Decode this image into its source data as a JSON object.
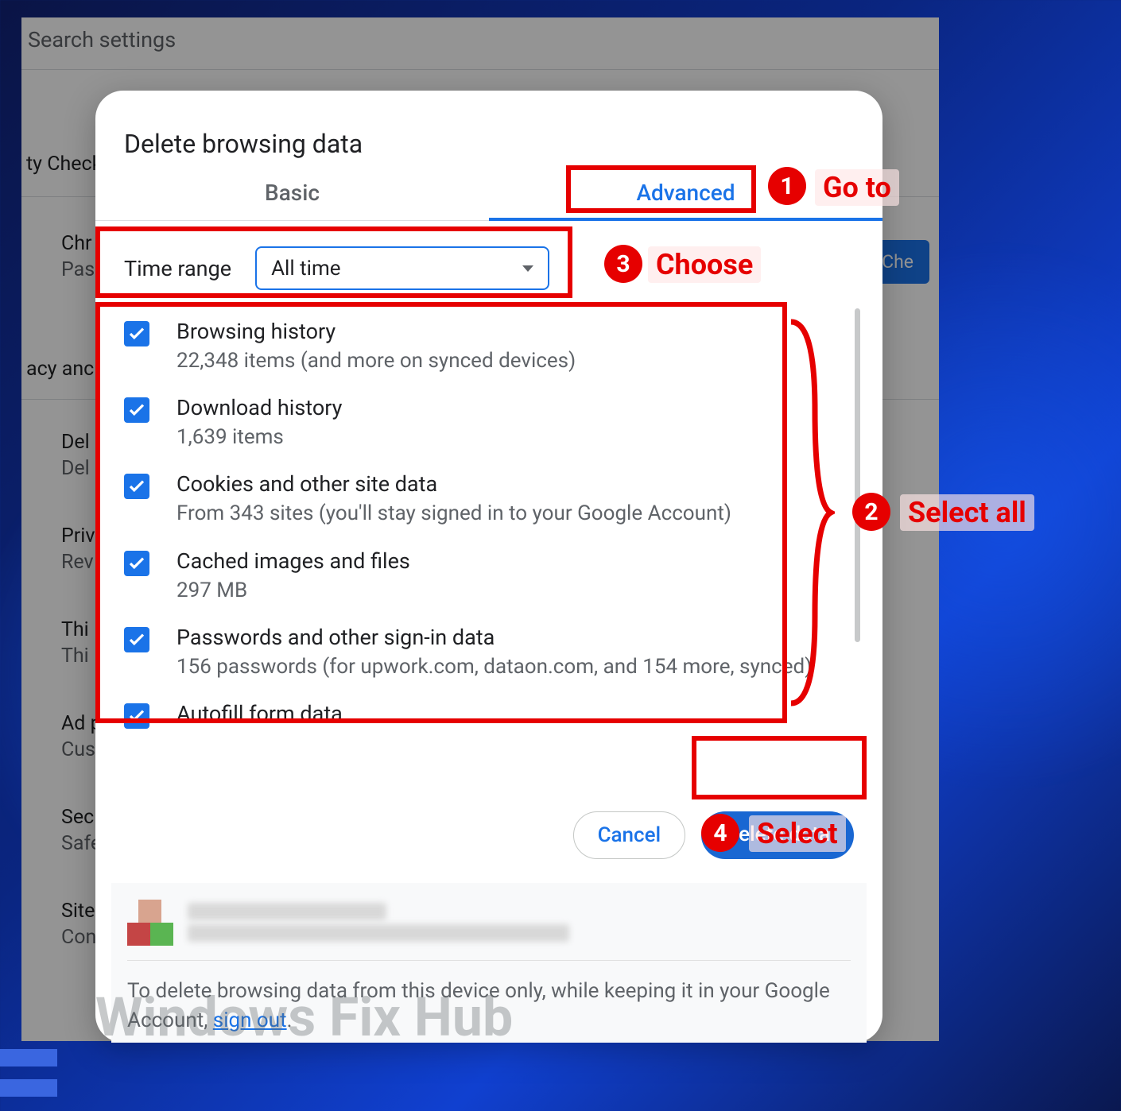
{
  "background_settings": {
    "search_placeholder": "Search settings",
    "section_safety_check": "ty Check",
    "item_chrome": "Chr",
    "item_chrome_sub": "Pass",
    "safety_btn": "ety Che",
    "section_privacy": "acy anc",
    "item_delete": "Del",
    "item_delete_sub": "Del",
    "item_privacy": "Priv",
    "item_privacy_sub": "Rev",
    "item_third": "Thi",
    "item_third_sub": "Thi",
    "item_ad": "Ad p",
    "item_ad_sub": "Cus",
    "item_security": "Sec",
    "item_security_sub": "Safe",
    "item_site": "Site",
    "item_site_sub": "Con"
  },
  "dialog": {
    "title": "Delete browsing data",
    "tabs": {
      "basic": "Basic",
      "advanced": "Advanced"
    },
    "time_range_label": "Time range",
    "time_range_value": "All time",
    "options": [
      {
        "title": "Browsing history",
        "sub": "22,348 items (and more on synced devices)"
      },
      {
        "title": "Download history",
        "sub": "1,639 items"
      },
      {
        "title": "Cookies and other site data",
        "sub": "From 343 sites (you'll stay signed in to your Google Account)"
      },
      {
        "title": "Cached images and files",
        "sub": "297 MB"
      },
      {
        "title": "Passwords and other sign-in data",
        "sub": "156 passwords (for upwork.com, dataon.com, and 154 more, synced)"
      },
      {
        "title": "Autofill form data",
        "sub": ""
      }
    ],
    "cancel": "Cancel",
    "delete": "Delete data",
    "account_note_pre": "To delete browsing data from this device only, while keeping it in your Google Account, ",
    "account_note_link": "sign out",
    "account_note_post": "."
  },
  "annotations": {
    "1": "Go to",
    "2": "Select all",
    "3": "Choose",
    "4": "Select"
  },
  "watermark": "Windows Fix Hub"
}
